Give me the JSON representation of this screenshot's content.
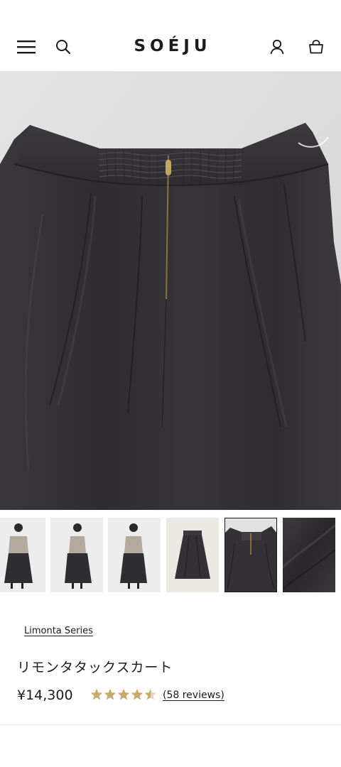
{
  "header": {
    "logo": "SOÉJU",
    "menu_icon": "hamburger-menu-icon",
    "search_icon": "search-icon",
    "account_icon": "account-icon",
    "cart_icon": "shopping-bag-icon"
  },
  "gallery": {
    "main_image": "skirt-back-waistband-closeup",
    "thumbnails": [
      {
        "name": "model-front"
      },
      {
        "name": "model-side"
      },
      {
        "name": "model-back"
      },
      {
        "name": "skirt-flat"
      },
      {
        "name": "waistband-closeup",
        "active": true
      },
      {
        "name": "fabric-detail"
      }
    ]
  },
  "product": {
    "series": "Limonta Series",
    "title": "リモンタタックスカート",
    "price": "¥14,300",
    "rating": 4.5,
    "rating_max": 5,
    "reviews_label": "(58 reviews)"
  },
  "colors": {
    "star": "#c9a96b",
    "star_empty": "#e0d6c4",
    "fabric": "#333136"
  }
}
